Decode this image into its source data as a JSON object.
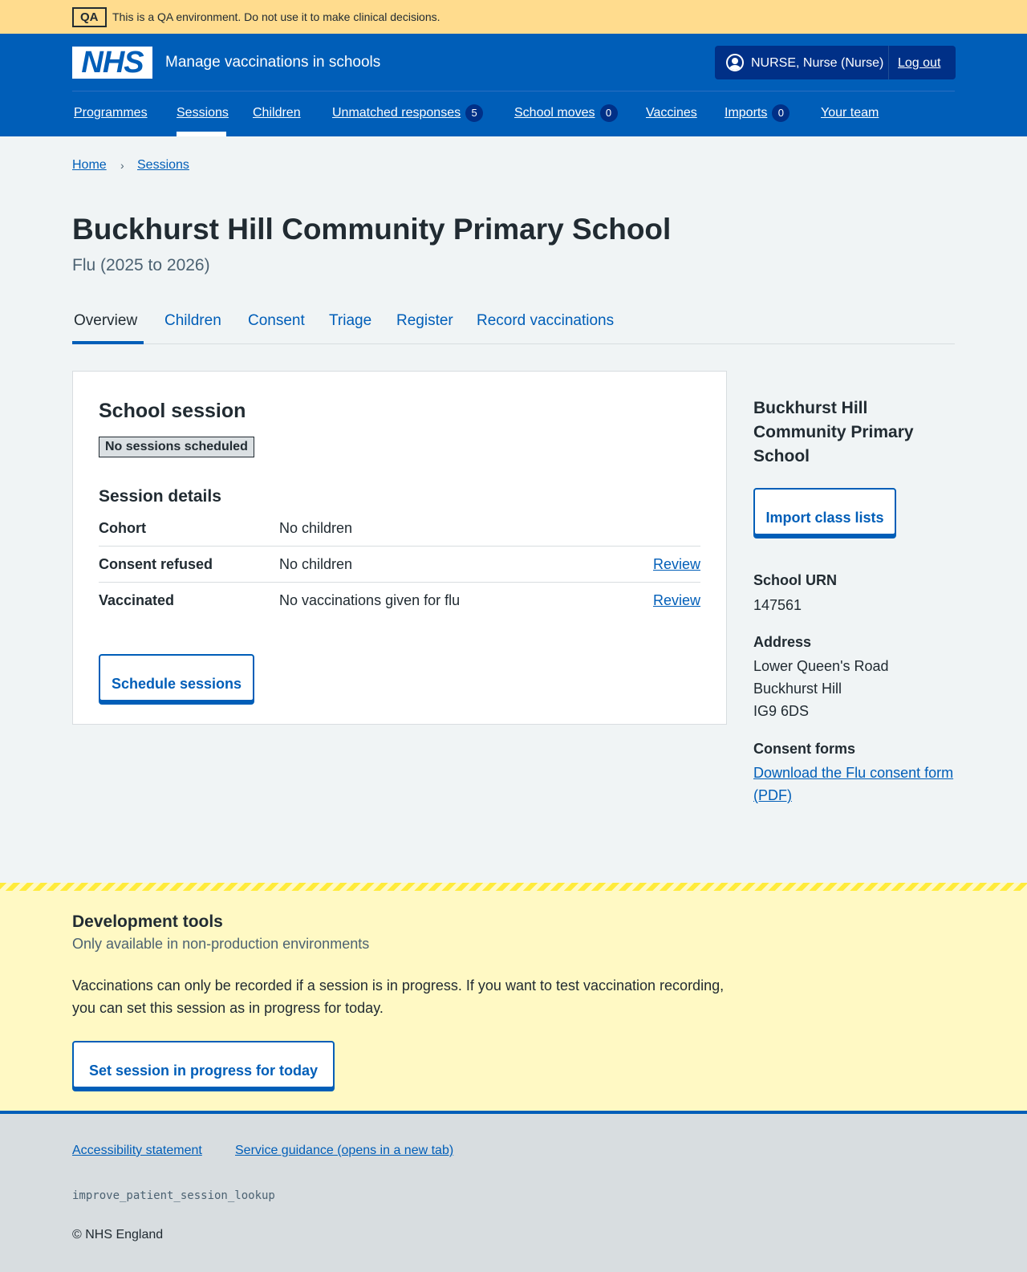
{
  "qa_banner": {
    "tag": "QA",
    "text": "This is a QA environment. Do not use it to make clinical decisions."
  },
  "header": {
    "logo_text": "NHS",
    "service_name": "Manage vaccinations in schools",
    "user_name": "NURSE, Nurse (Nurse)",
    "logout_label": "Log out",
    "nav": [
      {
        "label": "Programmes"
      },
      {
        "label": "Sessions",
        "active": true
      },
      {
        "label": "Children"
      },
      {
        "label": "Unmatched responses",
        "badge": "5"
      },
      {
        "label": "School moves",
        "badge": "0"
      },
      {
        "label": "Vaccines"
      },
      {
        "label": "Imports",
        "badge": "0"
      },
      {
        "label": "Your team"
      }
    ]
  },
  "breadcrumb": [
    {
      "label": "Home"
    },
    {
      "label": "Sessions"
    }
  ],
  "page": {
    "title": "Buckhurst Hill Community Primary School",
    "caption": "Flu (2025 to 2026)"
  },
  "tabs": [
    {
      "label": "Overview",
      "active": true
    },
    {
      "label": "Children"
    },
    {
      "label": "Consent"
    },
    {
      "label": "Triage"
    },
    {
      "label": "Register"
    },
    {
      "label": "Record vaccinations"
    }
  ],
  "session_card": {
    "title": "School session",
    "status_tag": "No sessions scheduled",
    "details_title": "Session details",
    "rows": [
      {
        "key": "Cohort",
        "value": "No children",
        "action": ""
      },
      {
        "key": "Consent refused",
        "value": "No children",
        "action": "Review"
      },
      {
        "key": "Vaccinated",
        "value": "No vaccinations given for flu",
        "action": "Review"
      }
    ],
    "schedule_button": "Schedule sessions"
  },
  "side": {
    "title": "Buckhurst Hill Community Primary School",
    "import_button": "Import class lists",
    "urn_label": "School URN",
    "urn_value": "147561",
    "address_label": "Address",
    "address_lines": [
      "Lower Queen's Road",
      "Buckhurst Hill",
      "IG9 6DS"
    ],
    "consent_forms_label": "Consent forms",
    "consent_form_link": "Download the Flu consent form (PDF)"
  },
  "dev_tools": {
    "title": "Development tools",
    "caption": "Only available in non-production environments",
    "text": "Vaccinations can only be recorded if a session is in progress. If you want to test vaccination recording, you can set this session as in progress for today.",
    "button": "Set session in progress for today"
  },
  "footer": {
    "links": [
      {
        "label": "Accessibility statement"
      },
      {
        "label": "Service guidance (opens in a new tab)"
      }
    ],
    "feature_flag": "improve_patient_session_lookup",
    "copyright": "© NHS England"
  },
  "colors": {
    "brand_blue": "#005eb8",
    "dark_blue": "#003087",
    "qa_banner": "#ffdc8e",
    "dev_tools_bg": "#fff9c4",
    "page_bg": "#f0f4f5"
  }
}
